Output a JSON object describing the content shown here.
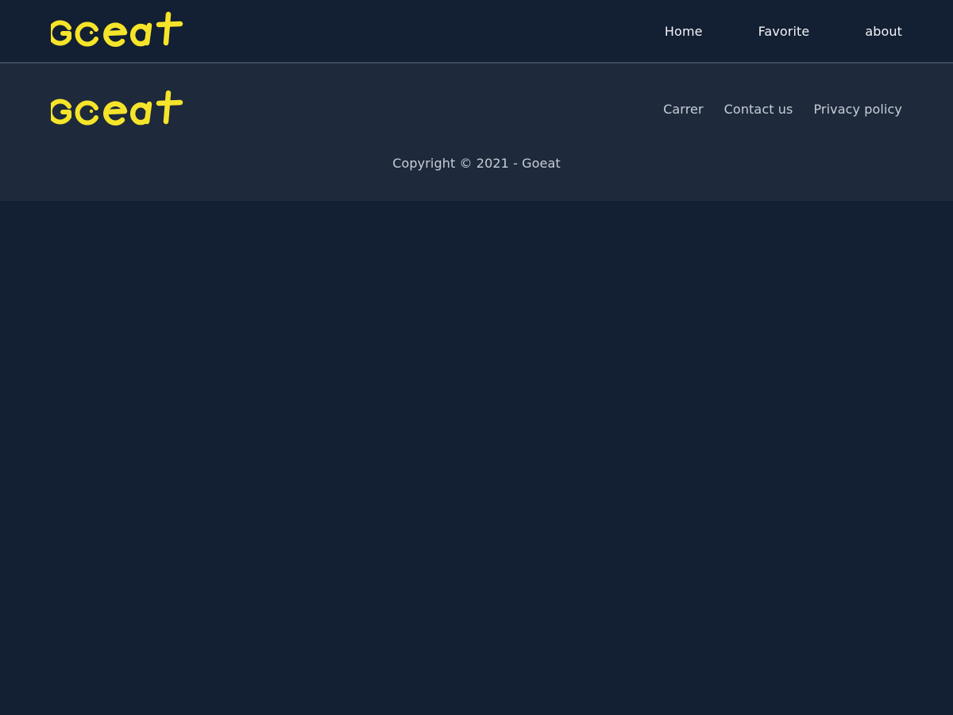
{
  "brand": {
    "logo_text": "Goeat",
    "logo_color": "#f5e42a",
    "icon": "goeat-logo-icon"
  },
  "navbar": {
    "links": [
      {
        "label": "Home"
      },
      {
        "label": "Favorite"
      },
      {
        "label": "about"
      }
    ]
  },
  "footer": {
    "links": [
      {
        "label": "Carrer"
      },
      {
        "label": "Contact us"
      },
      {
        "label": "Privacy policy"
      }
    ],
    "copyright": "Copyright © 2021 - Goeat"
  },
  "colors": {
    "background": "#131f32",
    "footer_background": "#1e293b",
    "divider": "#3e4a5d",
    "nav_text": "#f2f4f7",
    "footer_text": "#c8ced8"
  }
}
